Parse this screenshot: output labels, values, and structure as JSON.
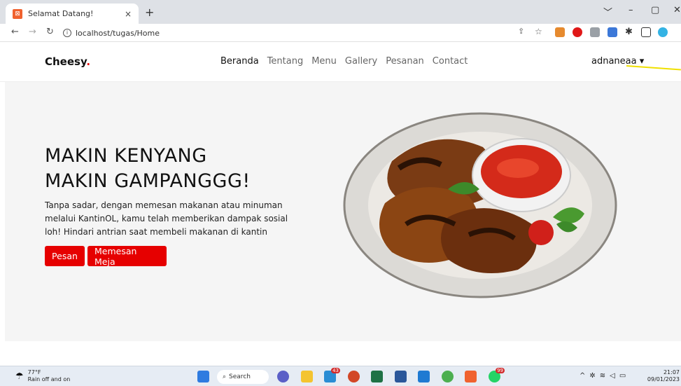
{
  "browser": {
    "tab_title": "Selamat Datang!",
    "tab_close": "×",
    "new_tab": "+",
    "url": "localhost/tugas/Home",
    "window_controls": [
      "﹀",
      "–",
      "▢",
      "✕"
    ]
  },
  "site": {
    "brand": "Cheesy",
    "brand_dot": ".",
    "nav": [
      "Beranda",
      "Tentang",
      "Menu",
      "Gallery",
      "Pesanan",
      "Contact"
    ],
    "user": "adnaneaa ▾"
  },
  "hero": {
    "title_line1": "MAKIN KENYANG",
    "title_line2": "MAKIN GAMPANGGG!",
    "text": "Tanpa sadar, dengan memesan makanan atau minuman melalui KantinOL, kamu telah memberikan dampak sosial loh! Hindari antrian saat membeli makanan di kantin",
    "btn_order": "Pesan",
    "btn_table": "Memesan Meja"
  },
  "taskbar": {
    "temp": "77°F",
    "weather": "Rain off and on",
    "search": "Search",
    "badge_1": "43",
    "badge_2": "99",
    "time": "21:07",
    "date": "09/01/2023"
  },
  "colors": {
    "accent": "#e60000",
    "hero_bg": "#f5f5f5"
  }
}
